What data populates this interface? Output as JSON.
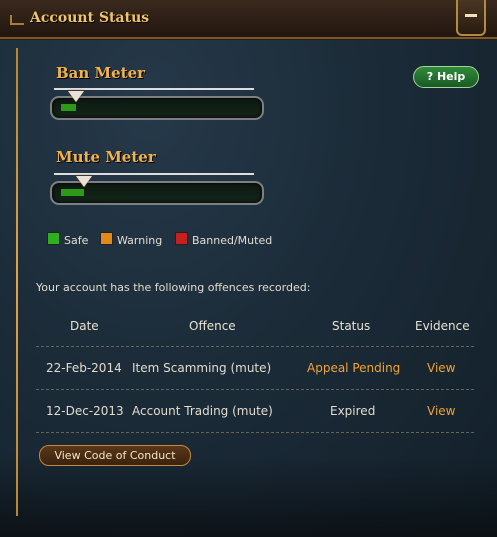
{
  "header": {
    "title": "Account Status"
  },
  "ban_meter": {
    "title": "Ban Meter",
    "level": 0.08
  },
  "mute_meter": {
    "title": "Mute Meter",
    "level": 0.12
  },
  "help": {
    "label": "? Help"
  },
  "legend": [
    {
      "label": "Safe",
      "color": "#2fae1f"
    },
    {
      "label": "Warning",
      "color": "#e08a1a"
    },
    {
      "label": "Banned/Muted",
      "color": "#c91f1f"
    }
  ],
  "intro_text": "Your account has the following offences recorded:",
  "table": {
    "headers": [
      "Date",
      "Offence",
      "Status",
      "Evidence"
    ],
    "rows": [
      {
        "date": "22-Feb-2014",
        "offence": "Item Scamming (mute)",
        "status": "Appeal Pending",
        "evidence": "View"
      },
      {
        "date": "12-Dec-2013",
        "offence": "Account Trading (mute)",
        "status": "Expired",
        "evidence": "View"
      }
    ]
  },
  "code_button": {
    "label": "View Code of Conduct"
  }
}
